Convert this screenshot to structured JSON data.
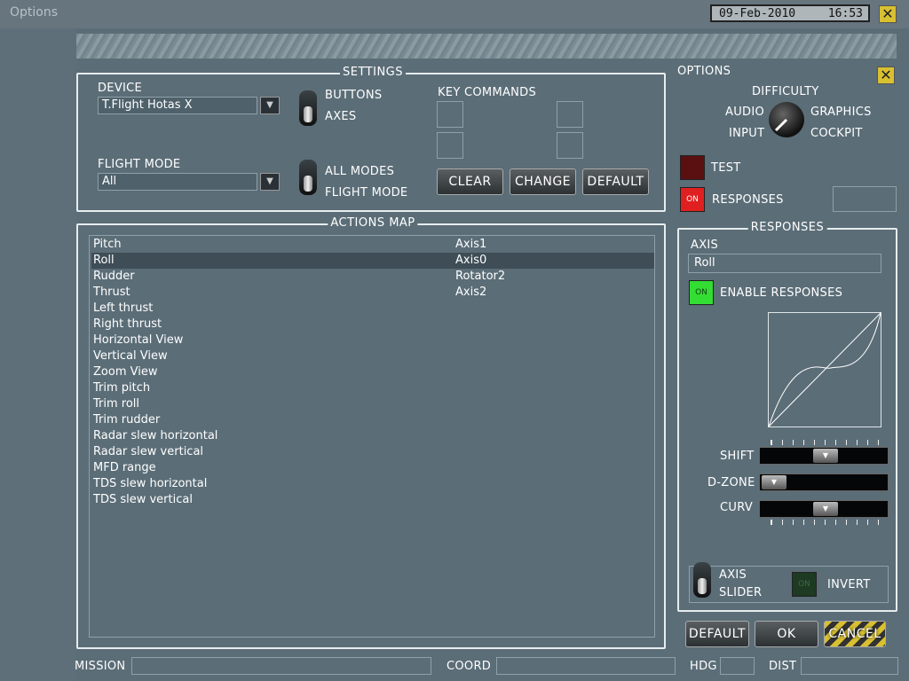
{
  "window": {
    "title": "Options",
    "date": "09-Feb-2010",
    "time": "16:53",
    "close": "✕"
  },
  "settings": {
    "legend": "SETTINGS",
    "device_label": "DEVICE",
    "device_value": "T.Flight Hotas X",
    "flight_mode_label": "FLIGHT MODE",
    "flight_mode_value": "All",
    "toggle1": {
      "top": "BUTTONS",
      "bottom": "AXES"
    },
    "toggle2": {
      "top": "ALL MODES",
      "bottom": "FLIGHT MODE"
    },
    "key_commands_label": "KEY COMMANDS",
    "buttons": {
      "clear": "CLEAR",
      "change": "CHANGE",
      "default": "DEFAULT"
    }
  },
  "options": {
    "legend": "OPTIONS",
    "difficulty": "DIFFICULTY",
    "audio": "AUDIO",
    "graphics": "GRAPHICS",
    "input": "INPUT",
    "cockpit": "COCKPIT",
    "test_label": "TEST",
    "responses_label": "RESPONSES",
    "led_on": "ON"
  },
  "actions_map": {
    "legend": "ACTIONS MAP",
    "rows": [
      {
        "action": "Pitch",
        "binding": "Axis1"
      },
      {
        "action": "Roll",
        "binding": "Axis0"
      },
      {
        "action": "Rudder",
        "binding": "Rotator2"
      },
      {
        "action": "Thrust",
        "binding": "Axis2"
      },
      {
        "action": "Left thrust",
        "binding": ""
      },
      {
        "action": "Right thrust",
        "binding": ""
      },
      {
        "action": "Horizontal View",
        "binding": ""
      },
      {
        "action": "Vertical View",
        "binding": ""
      },
      {
        "action": "Zoom View",
        "binding": ""
      },
      {
        "action": "Trim pitch",
        "binding": ""
      },
      {
        "action": "Trim roll",
        "binding": ""
      },
      {
        "action": "Trim rudder",
        "binding": ""
      },
      {
        "action": "Radar slew horizontal",
        "binding": ""
      },
      {
        "action": "Radar slew vertical",
        "binding": ""
      },
      {
        "action": "MFD range",
        "binding": ""
      },
      {
        "action": "TDS slew horizontal",
        "binding": ""
      },
      {
        "action": "TDS slew vertical",
        "binding": ""
      }
    ],
    "selected_index": 1
  },
  "responses": {
    "legend": "RESPONSES",
    "axis_label": "AXIS",
    "axis_value": "Roll",
    "enable_label": "ENABLE RESPONSES",
    "led_on": "ON",
    "shift_label": "SHIFT",
    "dzone_label": "D-ZONE",
    "curv_label": "CURV",
    "shift_value": 0.5,
    "dzone_value": 0.0,
    "curv_value": 0.5,
    "toggle": {
      "top": "AXIS",
      "bottom": "SLIDER"
    },
    "invert_label": "INVERT",
    "invert_led": "ON"
  },
  "footer": {
    "default": "DEFAULT",
    "ok": "OK",
    "cancel": "CANCEL",
    "mission": "MISSION",
    "coord": "COORD",
    "hdg": "HDG",
    "dist": "DIST"
  },
  "colors": {
    "background": "#5b6d77",
    "led_red": "#e02020",
    "led_dark_red": "#5a1010",
    "led_green": "#33dd33",
    "led_dark_green": "#1e3a22",
    "close_yellow": "#d8c030"
  }
}
